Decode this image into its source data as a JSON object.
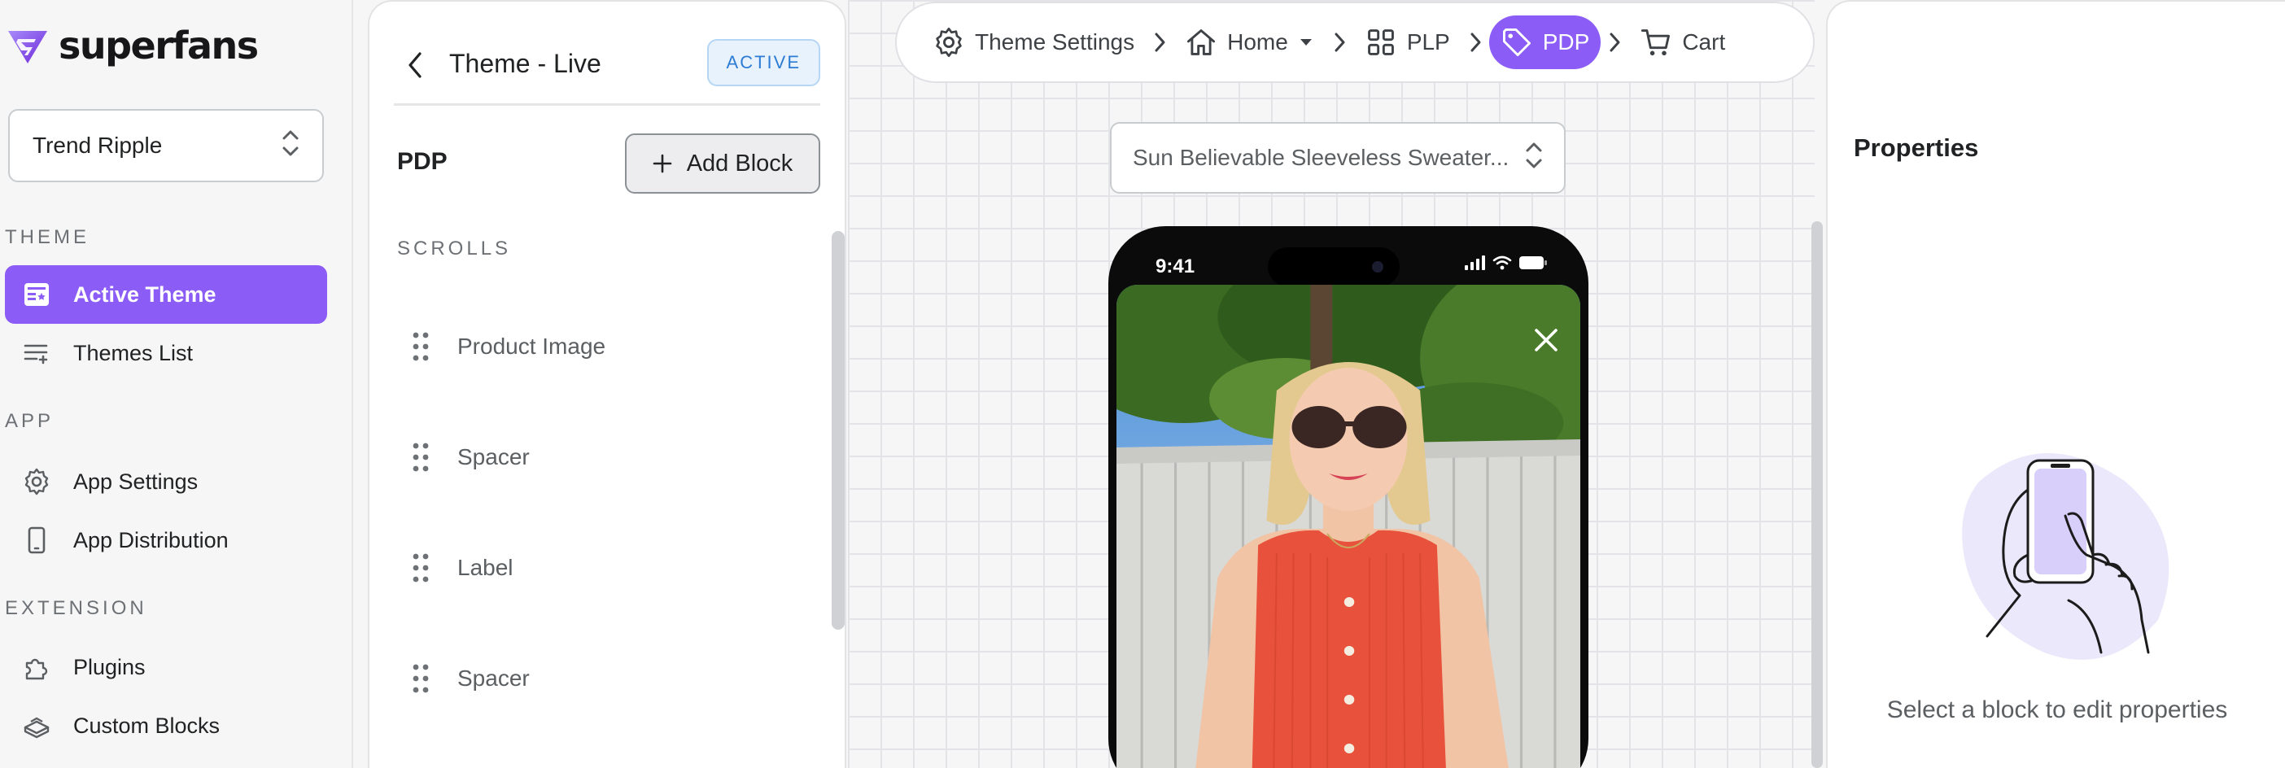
{
  "brand": {
    "name": "superfans",
    "accent": "#8b5cf6"
  },
  "store_selector": {
    "value": "Trend Ripple"
  },
  "nav": {
    "theme_heading": "THEME",
    "theme_items": [
      {
        "label": "Active Theme",
        "icon": "theme-icon",
        "active": true
      },
      {
        "label": "Themes List",
        "icon": "list-icon",
        "active": false
      }
    ],
    "app_heading": "APP",
    "app_items": [
      {
        "label": "App Settings",
        "icon": "gear-icon"
      },
      {
        "label": "App Distribution",
        "icon": "phone-icon"
      }
    ],
    "extension_heading": "EXTENSION",
    "extension_items": [
      {
        "label": "Plugins",
        "icon": "puzzle-icon"
      },
      {
        "label": "Custom Blocks",
        "icon": "blocks-icon"
      }
    ]
  },
  "blocks_panel": {
    "theme_title": "Theme - Live",
    "status_badge": "ACTIVE",
    "page_label": "PDP",
    "add_block_label": "Add Block",
    "section_heading": "SCROLLS",
    "items": [
      {
        "label": "Product Image"
      },
      {
        "label": "Spacer"
      },
      {
        "label": "Label"
      },
      {
        "label": "Spacer"
      }
    ]
  },
  "breadcrumb": {
    "items": [
      {
        "label": "Theme Settings",
        "icon": "gear-icon"
      },
      {
        "label": "Home",
        "icon": "home-icon",
        "dropdown": true
      },
      {
        "label": "PLP",
        "icon": "grid-icon"
      },
      {
        "label": "PDP",
        "icon": "tag-icon",
        "active": true
      },
      {
        "label": "Cart",
        "icon": "cart-icon"
      }
    ]
  },
  "preview": {
    "product_selector": "Sun Believable Sleeveless Sweater...",
    "status_time": "9:41"
  },
  "properties": {
    "title": "Properties",
    "empty_message": "Select a block to edit properties"
  }
}
